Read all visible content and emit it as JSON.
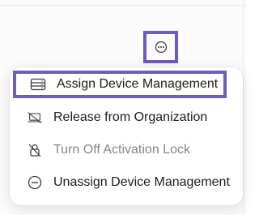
{
  "page": {
    "more_button": {
      "icon": "ellipsis-circle-icon"
    }
  },
  "menu": {
    "items": [
      {
        "label": "Assign Device Management",
        "icon": "server-icon",
        "enabled": true,
        "highlighted": true
      },
      {
        "label": "Release from Organization",
        "icon": "laptop-slash-icon",
        "enabled": true
      },
      {
        "label": "Turn Off Activation Lock",
        "icon": "lock-slash-icon",
        "enabled": false
      },
      {
        "label": "Unassign Device Management",
        "icon": "minus-circle-icon",
        "enabled": true
      }
    ]
  },
  "colors": {
    "highlight": "#6e5bbd",
    "text": "#1d1d1f",
    "disabled_text": "#86868b"
  }
}
